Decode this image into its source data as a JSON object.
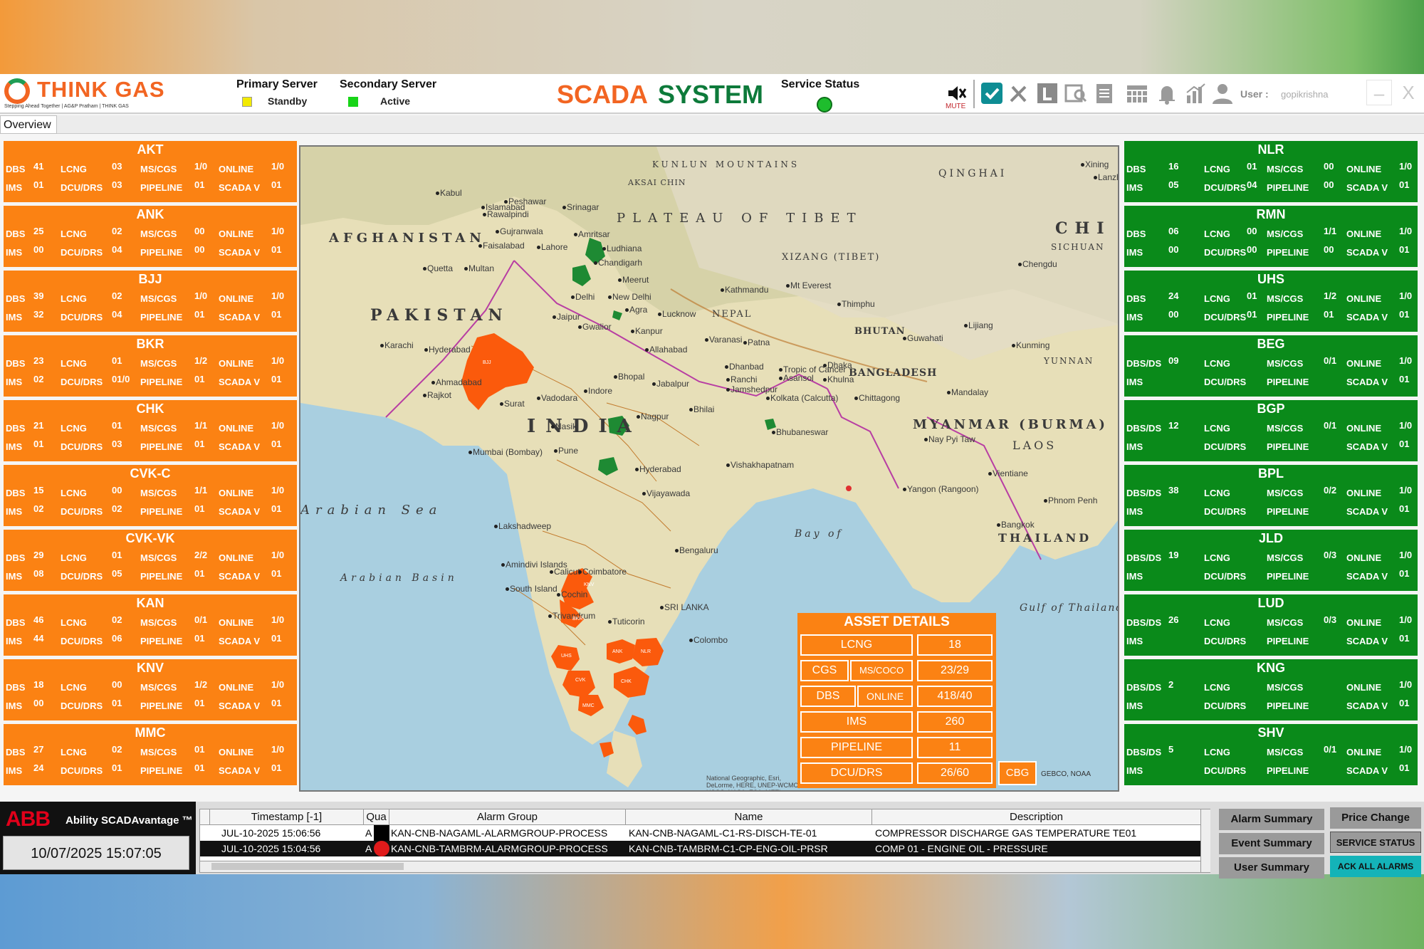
{
  "header": {
    "logo_text": "THINK GAS",
    "logo_tagline": "Stepping Ahead Together | AG&P Pratham | THINK GAS",
    "primary_server": {
      "label": "Primary Server",
      "state": "Standby",
      "color": "#f2ea00"
    },
    "secondary_server": {
      "label": "Secondary Server",
      "state": "Active",
      "color": "#18d418"
    },
    "title_part1": "SCADA",
    "title_part2": "SYSTEM",
    "service_status_label": "Service Status",
    "mute_label": "MUTE",
    "user_label": "User :",
    "user_name": "gopikrishna",
    "icons": [
      "mute-icon",
      "check-shield-icon",
      "tools-icon",
      "l-icon",
      "search-report-icon",
      "clipboard-icon",
      "calendar-icon",
      "bell-icon",
      "chart-icon",
      "user-icon"
    ],
    "minimize": "–",
    "close": "X"
  },
  "tabs": {
    "overview": "Overview"
  },
  "orange_panels": [
    {
      "name": "AKT",
      "r1": [
        "DBS",
        "41",
        "LCNG",
        "03",
        "MS/CGS",
        "1/0",
        "ONLINE",
        "1/0"
      ],
      "r2": [
        "IMS",
        "01",
        "DCU/DRS",
        "03",
        "PIPELINE",
        "01",
        "SCADA V",
        "01"
      ]
    },
    {
      "name": "ANK",
      "r1": [
        "DBS",
        "25",
        "LCNG",
        "02",
        "MS/CGS",
        "00",
        "ONLINE",
        "1/0"
      ],
      "r2": [
        "IMS",
        "00",
        "DCU/DRS",
        "04",
        "PIPELINE",
        "00",
        "SCADA V",
        "01"
      ]
    },
    {
      "name": "BJJ",
      "r1": [
        "DBS",
        "39",
        "LCNG",
        "02",
        "MS/CGS",
        "1/0",
        "ONLINE",
        "1/0"
      ],
      "r2": [
        "IMS",
        "32",
        "DCU/DRS",
        "04",
        "PIPELINE",
        "01",
        "SCADA V",
        "01"
      ]
    },
    {
      "name": "BKR",
      "r1": [
        "DBS",
        "23",
        "LCNG",
        "01",
        "MS/CGS",
        "1/2",
        "ONLINE",
        "1/0"
      ],
      "r2": [
        "IMS",
        "02",
        "DCU/DRS",
        "01/0",
        "PIPELINE",
        "01",
        "SCADA V",
        "01"
      ]
    },
    {
      "name": "CHK",
      "r1": [
        "DBS",
        "21",
        "LCNG",
        "01",
        "MS/CGS",
        "1/1",
        "ONLINE",
        "1/0"
      ],
      "r2": [
        "IMS",
        "01",
        "DCU/DRS",
        "03",
        "PIPELINE",
        "01",
        "SCADA V",
        "01"
      ]
    },
    {
      "name": "CVK-C",
      "r1": [
        "DBS",
        "15",
        "LCNG",
        "00",
        "MS/CGS",
        "1/1",
        "ONLINE",
        "1/0"
      ],
      "r2": [
        "IMS",
        "02",
        "DCU/DRS",
        "02",
        "PIPELINE",
        "01",
        "SCADA V",
        "01"
      ]
    },
    {
      "name": "CVK-VK",
      "r1": [
        "DBS",
        "29",
        "LCNG",
        "01",
        "MS/CGS",
        "2/2",
        "ONLINE",
        "1/0"
      ],
      "r2": [
        "IMS",
        "08",
        "DCU/DRS",
        "05",
        "PIPELINE",
        "01",
        "SCADA V",
        "01"
      ]
    },
    {
      "name": "KAN",
      "r1": [
        "DBS",
        "46",
        "LCNG",
        "02",
        "MS/CGS",
        "0/1",
        "ONLINE",
        "1/0"
      ],
      "r2": [
        "IMS",
        "44",
        "DCU/DRS",
        "06",
        "PIPELINE",
        "01",
        "SCADA V",
        "01"
      ]
    },
    {
      "name": "KNV",
      "r1": [
        "DBS",
        "18",
        "LCNG",
        "00",
        "MS/CGS",
        "1/2",
        "ONLINE",
        "1/0"
      ],
      "r2": [
        "IMS",
        "00",
        "DCU/DRS",
        "01",
        "PIPELINE",
        "01",
        "SCADA V",
        "01"
      ]
    },
    {
      "name": "MMC",
      "r1": [
        "DBS",
        "27",
        "LCNG",
        "02",
        "MS/CGS",
        "01",
        "ONLINE",
        "1/0"
      ],
      "r2": [
        "IMS",
        "24",
        "DCU/DRS",
        "01",
        "PIPELINE",
        "01",
        "SCADA V",
        "01"
      ]
    }
  ],
  "green_panels": [
    {
      "name": "NLR",
      "r1": [
        "DBS",
        "16",
        "LCNG",
        "01",
        "MS/CGS",
        "00",
        "ONLINE",
        "1/0"
      ],
      "r2": [
        "IMS",
        "05",
        "DCU/DRS",
        "04",
        "PIPELINE",
        "00",
        "SCADA V",
        "01"
      ]
    },
    {
      "name": "RMN",
      "r1": [
        "DBS",
        "06",
        "LCNG",
        "00",
        "MS/CGS",
        "1/1",
        "ONLINE",
        "1/0"
      ],
      "r2": [
        "IMS",
        "00",
        "DCU/DRS",
        "00",
        "PIPELINE",
        "00",
        "SCADA V",
        "01"
      ]
    },
    {
      "name": "UHS",
      "r1": [
        "DBS",
        "24",
        "LCNG",
        "01",
        "MS/CGS",
        "1/2",
        "ONLINE",
        "1/0"
      ],
      "r2": [
        "IMS",
        "00",
        "DCU/DRS",
        "01",
        "PIPELINE",
        "01",
        "SCADA V",
        "01"
      ]
    },
    {
      "name": "BEG",
      "r1": [
        "DBS/DS",
        "09",
        "LCNG",
        "",
        "MS/CGS",
        "0/1",
        "ONLINE",
        "1/0"
      ],
      "r2": [
        "IMS",
        "",
        "DCU/DRS",
        "",
        "PIPELINE",
        "",
        "SCADA V",
        "01"
      ]
    },
    {
      "name": "BGP",
      "r1": [
        "DBS/DS",
        "12",
        "LCNG",
        "",
        "MS/CGS",
        "0/1",
        "ONLINE",
        "1/0"
      ],
      "r2": [
        "IMS",
        "",
        "DCU/DRS",
        "",
        "PIPELINE",
        "",
        "SCADA V",
        "01"
      ]
    },
    {
      "name": "BPL",
      "r1": [
        "DBS/DS",
        "38",
        "LCNG",
        "",
        "MS/CGS",
        "0/2",
        "ONLINE",
        "1/0"
      ],
      "r2": [
        "IMS",
        "",
        "DCU/DRS",
        "",
        "PIPELINE",
        "",
        "SCADA V",
        "01"
      ]
    },
    {
      "name": "JLD",
      "r1": [
        "DBS/DS",
        "19",
        "LCNG",
        "",
        "MS/CGS",
        "0/3",
        "ONLINE",
        "1/0"
      ],
      "r2": [
        "IMS",
        "",
        "DCU/DRS",
        "",
        "PIPELINE",
        "",
        "SCADA V",
        "01"
      ]
    },
    {
      "name": "LUD",
      "r1": [
        "DBS/DS",
        "26",
        "LCNG",
        "",
        "MS/CGS",
        "0/3",
        "ONLINE",
        "1/0"
      ],
      "r2": [
        "IMS",
        "",
        "DCU/DRS",
        "",
        "PIPELINE",
        "",
        "SCADA V",
        "01"
      ]
    },
    {
      "name": "KNG",
      "r1": [
        "DBS/DS",
        "2",
        "LCNG",
        "",
        "MS/CGS",
        "",
        "ONLINE",
        "1/0"
      ],
      "r2": [
        "IMS",
        "",
        "DCU/DRS",
        "",
        "PIPELINE",
        "",
        "SCADA V",
        "01"
      ]
    },
    {
      "name": "SHV",
      "r1": [
        "DBS/DS",
        "5",
        "LCNG",
        "",
        "MS/CGS",
        "0/1",
        "ONLINE",
        "1/0"
      ],
      "r2": [
        "IMS",
        "",
        "DCU/DRS",
        "",
        "PIPELINE",
        "",
        "SCADA V",
        "01"
      ]
    }
  ],
  "map": {
    "labels": [
      "AFGHANISTAN",
      "PAKISTAN",
      "INDIA",
      "PLATEAU OF TIBET",
      "XIZANG (TIBET)",
      "NEPAL",
      "BHUTAN",
      "BANGLADESH",
      "MYANMAR (BURMA)",
      "LAOS",
      "THAILAND",
      "Arabian Sea",
      "Arabian Basin",
      "Bay of",
      "Gulf of Thailand",
      "KUNLUN MOUNTAINS",
      "QINGHAI",
      "CHI",
      "SICHUAN",
      "YUNNAN",
      "AKSAI CHIN"
    ],
    "cities": [
      "Kabul",
      "Peshawar",
      "Islamabad",
      "Rawalpindi",
      "Srinagar",
      "Gujranwala",
      "Faisalabad",
      "Lahore",
      "Amritsar",
      "Ludhiana",
      "Chandigarh",
      "Quetta",
      "Multan",
      "Meerut",
      "Delhi",
      "New Delhi",
      "Agra",
      "Lucknow",
      "Jaipur",
      "Gwalior",
      "Kanpur",
      "Allahabad",
      "Varanasi",
      "Patna",
      "Karachi",
      "Hyderabad",
      "Ahmadabad",
      "Rajkot",
      "Surat",
      "Vadodara",
      "Bhopal",
      "Indore",
      "Jabalpur",
      "Nagpur",
      "Bhilai",
      "Ranchi",
      "Dhanbad",
      "Asansol",
      "Jamshedpur",
      "Kolkata (Calcutta)",
      "Khulna",
      "Chittagong",
      "Dhaka",
      "Bhubaneswar",
      "Nasik",
      "Pune",
      "Mumbai (Bombay)",
      "Hyderabad",
      "Vishakhapatnam",
      "Vijayawada",
      "Bengaluru",
      "Calicut",
      "Coimbatore",
      "Cochin",
      "Trivandrum",
      "Tuticorin",
      "Colombo",
      "Kathmandu",
      "Thimphu",
      "Guwahati",
      "Mandalay",
      "Nay Pyi Taw",
      "Yangon (Rangoon)",
      "Bangkok",
      "Vientiane",
      "Phnom Penh",
      "Kunming",
      "Lijiang",
      "Chengdu",
      "Xining",
      "Lanzhou",
      "Mt Everest",
      "Tropic of Cancer",
      "Lakshadweep",
      "Amindivi Islands",
      "South Island",
      "SRI LANKA"
    ],
    "region_tags": [
      "BJJ",
      "KNV",
      "BKR",
      "UHS",
      "ANK",
      "NLR",
      "CVK",
      "CHK",
      "MMC"
    ],
    "credit": "National Geographic, Esri, DeLorme, HERE, UNEP-WCMC, USGS, NASA, ESA, METI, NRCAN, GEBCO, NOAA",
    "gebco": "GEBCO, NOAA"
  },
  "asset_details": {
    "title": "ASSET DETAILS",
    "lcng_label": "LCNG",
    "lcng_value": "18",
    "cgs_label": "CGS",
    "mscoco_label": "MS/COCO",
    "cgs_value": "23/29",
    "dbs_label": "DBS",
    "online_label": "ONLINE",
    "dbs_value": "418/40",
    "ims_label": "IMS",
    "ims_value": "260",
    "pipeline_label": "PIPELINE",
    "pipeline_value": "11",
    "dcu_label": "DCU/DRS",
    "dcu_value": "26/60",
    "cbg_label": "CBG"
  },
  "bottom": {
    "abb_logo": "ABB",
    "abb_product": "Ability SCADAvantage ™",
    "clock": "10/07/2025 15:07:05",
    "table_headers": [
      "Timestamp [-1]",
      "Qua",
      "Alarm Group",
      "Name",
      "Description"
    ],
    "rows": [
      {
        "timestamp": "JUL-10-2025 15:06:56",
        "qua": "A",
        "group": "KAN-CNB-NAGAML-ALARMGROUP-PROCESS",
        "name": "KAN-CNB-NAGAML-C1-RS-DISCH-TE-01",
        "desc": "COMPRESSOR DISCHARGE GAS TEMPERATURE TE01"
      },
      {
        "timestamp": "JUL-10-2025 15:04:56",
        "qua": "A",
        "group": "KAN-CNB-TAMBRM-ALARMGROUP-PROCESS",
        "name": "KAN-CNB-TAMBRM-C1-CP-ENG-OIL-PRSR",
        "desc": "COMP 01 - ENGINE OIL - PRESSURE"
      }
    ],
    "buttons": {
      "alarm_summary": "Alarm Summary",
      "event_summary": "Event Summary",
      "user_summary": "User Summary",
      "price_change": "Price Change",
      "service_status": "SERVICE STATUS",
      "ack_all": "ACK ALL ALARMS"
    }
  },
  "colors": {
    "orange": "#fb8213",
    "green": "#0a8a1a",
    "brand_orange": "#f26522",
    "brand_green": "#0d7a3a"
  }
}
